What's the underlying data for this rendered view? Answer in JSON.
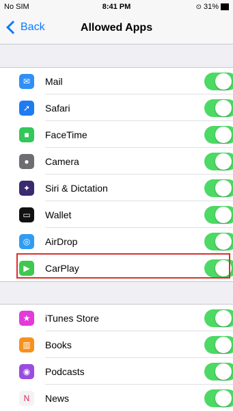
{
  "status": {
    "carrier": "No SIM",
    "time": "8:41 PM",
    "battery": "31%"
  },
  "nav": {
    "back_label": "Back",
    "title": "Allowed Apps"
  },
  "section1": [
    {
      "label": "Mail",
      "icon": "mail-icon",
      "color": "#2f8ff5",
      "enabled": true
    },
    {
      "label": "Safari",
      "icon": "safari-icon",
      "color": "#1e7cf2",
      "enabled": true
    },
    {
      "label": "FaceTime",
      "icon": "facetime-icon",
      "color": "#34c759",
      "enabled": true
    },
    {
      "label": "Camera",
      "icon": "camera-icon",
      "color": "#6d6d72",
      "enabled": true
    },
    {
      "label": "Siri & Dictation",
      "icon": "siri-icon",
      "color": "#3a2a6e",
      "enabled": true
    },
    {
      "label": "Wallet",
      "icon": "wallet-icon",
      "color": "#111111",
      "enabled": true
    },
    {
      "label": "AirDrop",
      "icon": "airdrop-icon",
      "color": "#2f9cf2",
      "enabled": true
    },
    {
      "label": "CarPlay",
      "icon": "carplay-icon",
      "color": "#3fc84f",
      "enabled": true
    }
  ],
  "section2": [
    {
      "label": "iTunes Store",
      "icon": "itunes-store-icon",
      "color": "#e33bd9",
      "enabled": true
    },
    {
      "label": "Books",
      "icon": "books-icon",
      "color": "#f6911d",
      "enabled": true
    },
    {
      "label": "Podcasts",
      "icon": "podcasts-icon",
      "color": "#9a4ce0",
      "enabled": true
    },
    {
      "label": "News",
      "icon": "news-icon",
      "color": "#f3f3f3",
      "enabled": true
    }
  ],
  "accent_color": "#0a7aff",
  "toggle_on_color": "#4cd964",
  "highlight_color": "#d9302c"
}
